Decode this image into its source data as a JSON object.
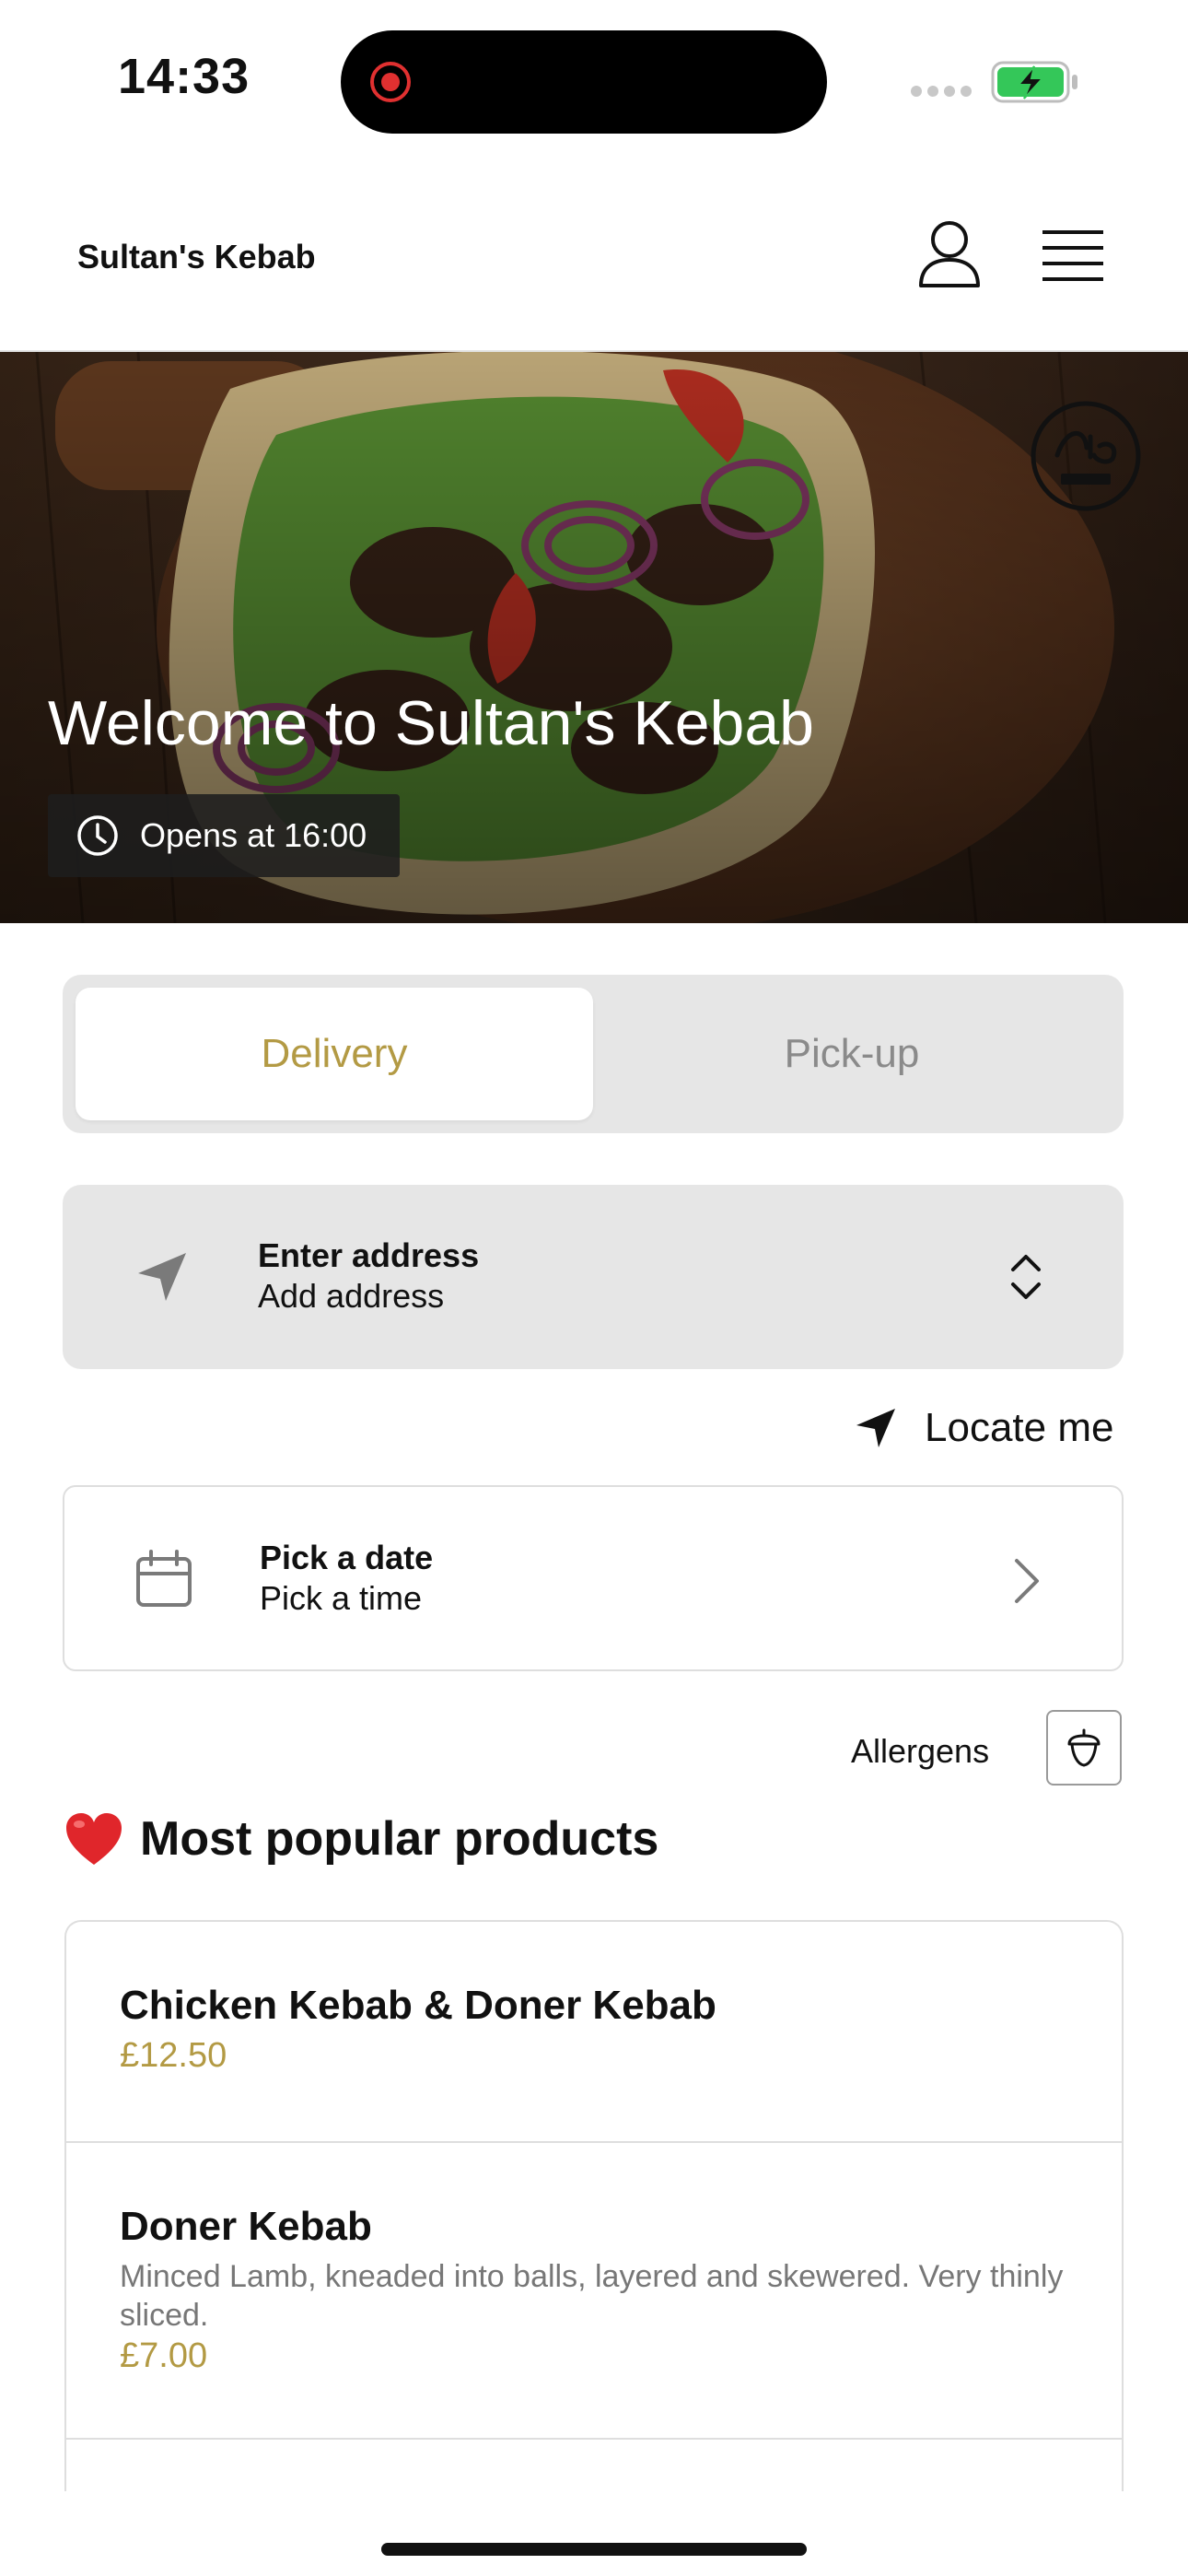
{
  "status_bar": {
    "time": "14:33"
  },
  "header": {
    "brand": "Sultan's Kebab"
  },
  "hero": {
    "title": "Welcome to Sultan's Kebab",
    "opening": "Opens at 16:00",
    "badge_icon": "halal-badge"
  },
  "order_mode": {
    "options": [
      "Delivery",
      "Pick-up"
    ],
    "selected": "Delivery"
  },
  "address": {
    "title": "Enter address",
    "subtitle": "Add address"
  },
  "locate_label": "Locate me",
  "schedule": {
    "title": "Pick a date",
    "subtitle": "Pick a time"
  },
  "allergens_label": "Allergens",
  "popular": {
    "title": "Most popular products",
    "items": [
      {
        "name": "Chicken Kebab & Doner Kebab",
        "description": "",
        "price": "£12.50"
      },
      {
        "name": "Doner Kebab",
        "description": "Minced Lamb, kneaded into balls, layered and skewered. Very thinly sliced.",
        "price": "£7.00"
      }
    ]
  },
  "colors": {
    "accent": "#b39a44",
    "panel": "#e6e6e6"
  }
}
